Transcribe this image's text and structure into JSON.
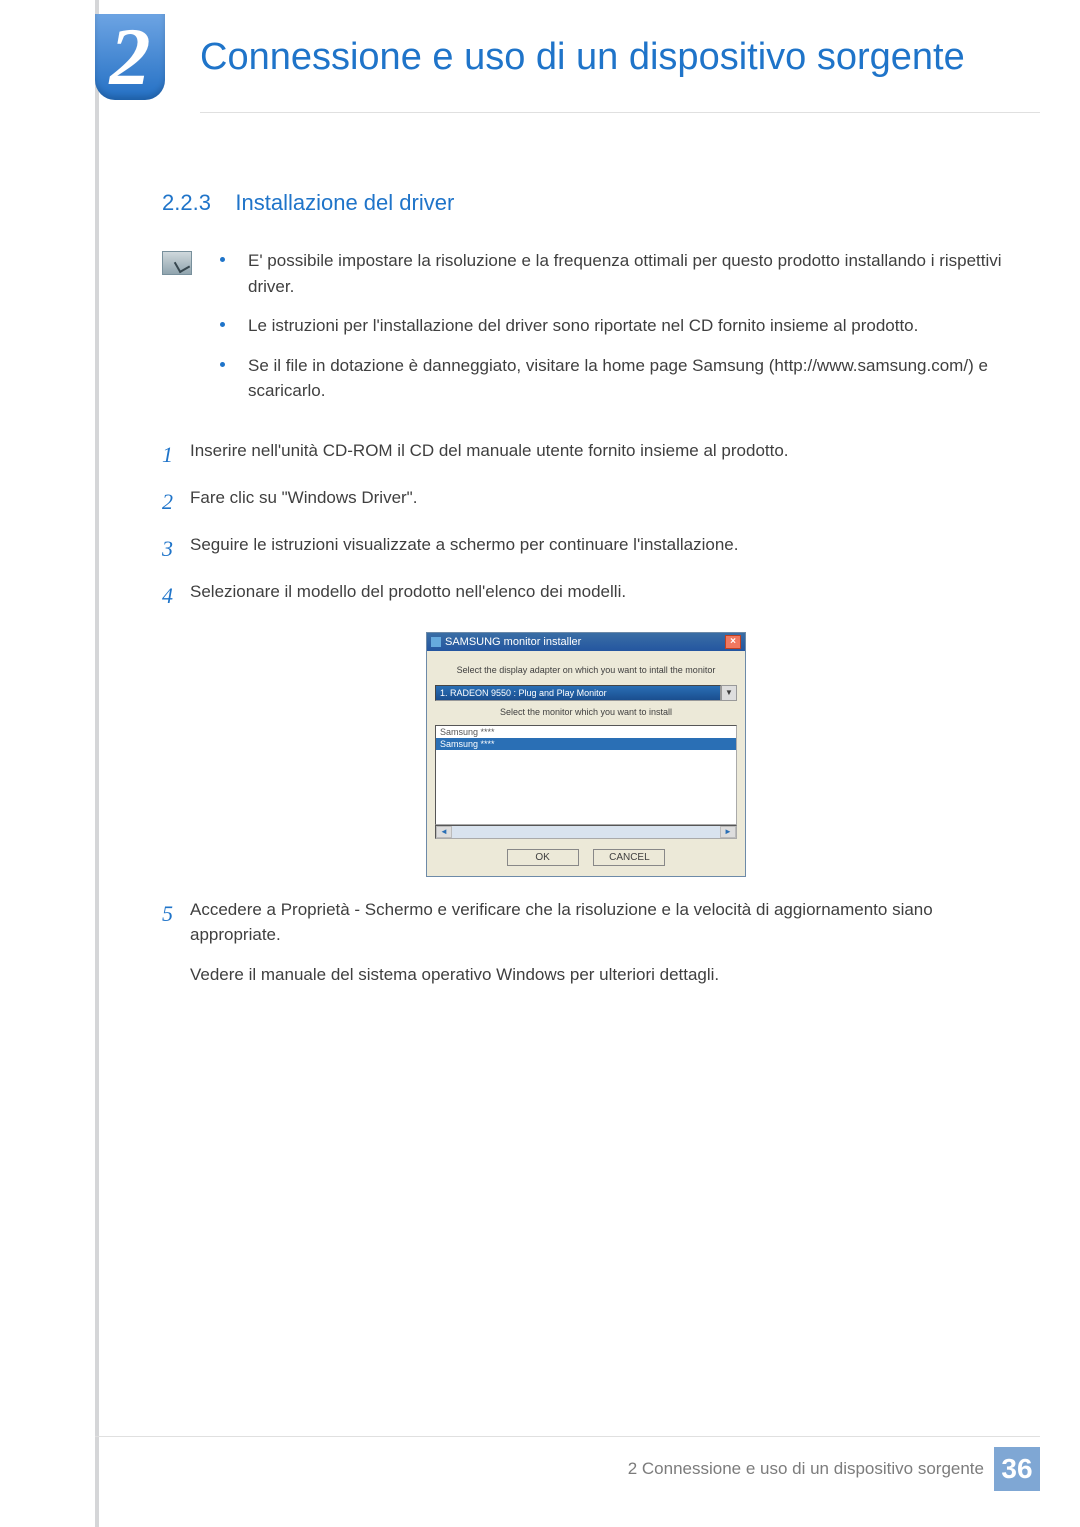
{
  "header": {
    "chapter_number": "2",
    "chapter_title": "Connessione e uso di un dispositivo sorgente"
  },
  "section": {
    "number": "2.2.3",
    "title": "Installazione del driver"
  },
  "notes": [
    "E' possibile impostare la risoluzione e la frequenza ottimali per questo prodotto installando i rispettivi driver.",
    "Le istruzioni per l'installazione del driver sono riportate nel CD fornito insieme al prodotto.",
    "Se il file in dotazione è danneggiato, visitare la home page Samsung (http://www.samsung.com/) e scaricarlo."
  ],
  "steps": [
    {
      "n": "1",
      "text": "Inserire nell'unità CD-ROM il CD del manuale utente fornito insieme al prodotto."
    },
    {
      "n": "2",
      "text": "Fare clic su \"Windows Driver\"."
    },
    {
      "n": "3",
      "text": "Seguire le istruzioni visualizzate a schermo per continuare l'installazione."
    },
    {
      "n": "4",
      "text": "Selezionare il modello del prodotto nell'elenco dei modelli."
    },
    {
      "n": "5",
      "text": "Accedere a Proprietà - Schermo e verificare che la risoluzione e la velocità di aggiornamento siano appropriate."
    }
  ],
  "step5_note": "Vedere il manuale del sistema operativo Windows per ulteriori dettagli.",
  "installer": {
    "title": "SAMSUNG monitor installer",
    "close": "×",
    "msg1": "Select the display adapter on which you want to intall the monitor",
    "dropdown_value": "1. RADEON 9550 : Plug and Play Monitor",
    "dropdown_arrow": "▼",
    "msg2": "Select the monitor which you want to install",
    "list_item1": "Samsung ****",
    "list_item2": "Samsung ****",
    "arrow_left": "◄",
    "arrow_right": "►",
    "btn_ok": "OK",
    "btn_cancel": "CANCEL"
  },
  "footer": {
    "text": "2 Connessione e uso di un dispositivo sorgente",
    "page": "36"
  }
}
